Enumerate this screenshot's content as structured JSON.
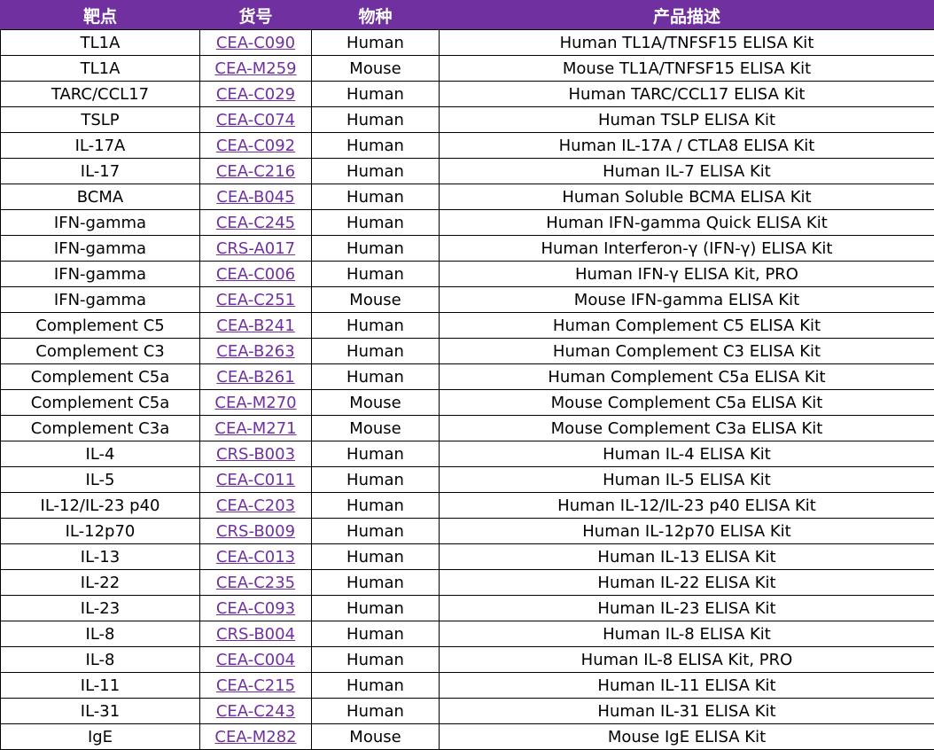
{
  "colors": {
    "header_bg": "#7030a0",
    "header_text": "#ffffff",
    "link": "#7030a0",
    "border": "#000000"
  },
  "headers": {
    "target": "靶点",
    "catalog": "货号",
    "species": "物种",
    "description": "产品描述"
  },
  "rows": [
    {
      "target": "TL1A",
      "catalog": "CEA-C090",
      "species": "Human",
      "description": "Human TL1A/TNFSF15 ELISA Kit"
    },
    {
      "target": "TL1A",
      "catalog": "CEA-M259",
      "species": "Mouse",
      "description": "Mouse TL1A/TNFSF15 ELISA Kit"
    },
    {
      "target": "TARC/CCL17",
      "catalog": "CEA-C029",
      "species": "Human",
      "description": "Human TARC/CCL17 ELISA Kit"
    },
    {
      "target": "TSLP",
      "catalog": "CEA-C074",
      "species": "Human",
      "description": "Human TSLP ELISA Kit"
    },
    {
      "target": "IL-17A",
      "catalog": "CEA-C092",
      "species": "Human",
      "description": "Human IL-17A / CTLA8 ELISA Kit"
    },
    {
      "target": "IL-17",
      "catalog": "CEA-C216",
      "species": "Human",
      "description": "Human IL-7 ELISA Kit"
    },
    {
      "target": "BCMA",
      "catalog": "CEA-B045",
      "species": "Human",
      "description": "Human Soluble BCMA ELISA Kit"
    },
    {
      "target": "IFN-gamma",
      "catalog": "CEA-C245",
      "species": "Human",
      "description": "Human IFN-gamma Quick ELISA Kit"
    },
    {
      "target": "IFN-gamma",
      "catalog": "CRS-A017",
      "species": "Human",
      "description": "Human Interferon-γ (IFN-γ) ELISA Kit"
    },
    {
      "target": "IFN-gamma",
      "catalog": "CEA-C006",
      "species": "Human",
      "description": "Human IFN-γ ELISA Kit, PRO"
    },
    {
      "target": "IFN-gamma",
      "catalog": "CEA-C251",
      "species": "Mouse",
      "description": "Mouse IFN-gamma ELISA Kit"
    },
    {
      "target": "Complement C5",
      "catalog": "CEA-B241",
      "species": "Human",
      "description": "Human Complement C5 ELISA Kit"
    },
    {
      "target": "Complement C3",
      "catalog": "CEA-B263",
      "species": "Human",
      "description": "Human Complement C3 ELISA Kit"
    },
    {
      "target": "Complement C5a",
      "catalog": "CEA-B261",
      "species": "Human",
      "description": "Human Complement C5a ELISA Kit"
    },
    {
      "target": "Complement C5a",
      "catalog": "CEA-M270",
      "species": "Mouse",
      "description": "Mouse Complement C5a ELISA Kit"
    },
    {
      "target": "Complement C3a",
      "catalog": "CEA-M271",
      "species": "Mouse",
      "description": "Mouse Complement C3a ELISA Kit"
    },
    {
      "target": "IL-4",
      "catalog": "CRS-B003",
      "species": "Human",
      "description": "Human IL-4 ELISA Kit"
    },
    {
      "target": "IL-5",
      "catalog": "CEA-C011",
      "species": "Human",
      "description": "Human IL-5 ELISA Kit"
    },
    {
      "target": "IL-12/IL-23 p40",
      "catalog": "CEA-C203",
      "species": "Human",
      "description": "Human IL-12/IL-23 p40 ELISA Kit"
    },
    {
      "target": "IL-12p70",
      "catalog": "CRS-B009",
      "species": "Human",
      "description": "Human IL-12p70 ELISA Kit"
    },
    {
      "target": "IL-13",
      "catalog": "CEA-C013",
      "species": "Human",
      "description": "Human IL-13 ELISA Kit"
    },
    {
      "target": "IL-22",
      "catalog": "CEA-C235",
      "species": "Human",
      "description": "Human IL-22 ELISA Kit"
    },
    {
      "target": "IL-23",
      "catalog": "CEA-C093",
      "species": "Human",
      "description": "Human IL-23 ELISA Kit"
    },
    {
      "target": "IL-8",
      "catalog": "CRS-B004",
      "species": "Human",
      "description": "Human IL-8 ELISA Kit"
    },
    {
      "target": "IL-8",
      "catalog": "CEA-C004",
      "species": "Human",
      "description": "Human IL-8 ELISA Kit, PRO"
    },
    {
      "target": "IL-11",
      "catalog": "CEA-C215",
      "species": "Human",
      "description": "Human IL-11 ELISA Kit"
    },
    {
      "target": "IL-31",
      "catalog": "CEA-C243",
      "species": "Human",
      "description": "Human IL-31 ELISA Kit"
    },
    {
      "target": "IgE",
      "catalog": "CEA-M282",
      "species": "Mouse",
      "description": "Mouse IgE ELISA Kit"
    }
  ]
}
